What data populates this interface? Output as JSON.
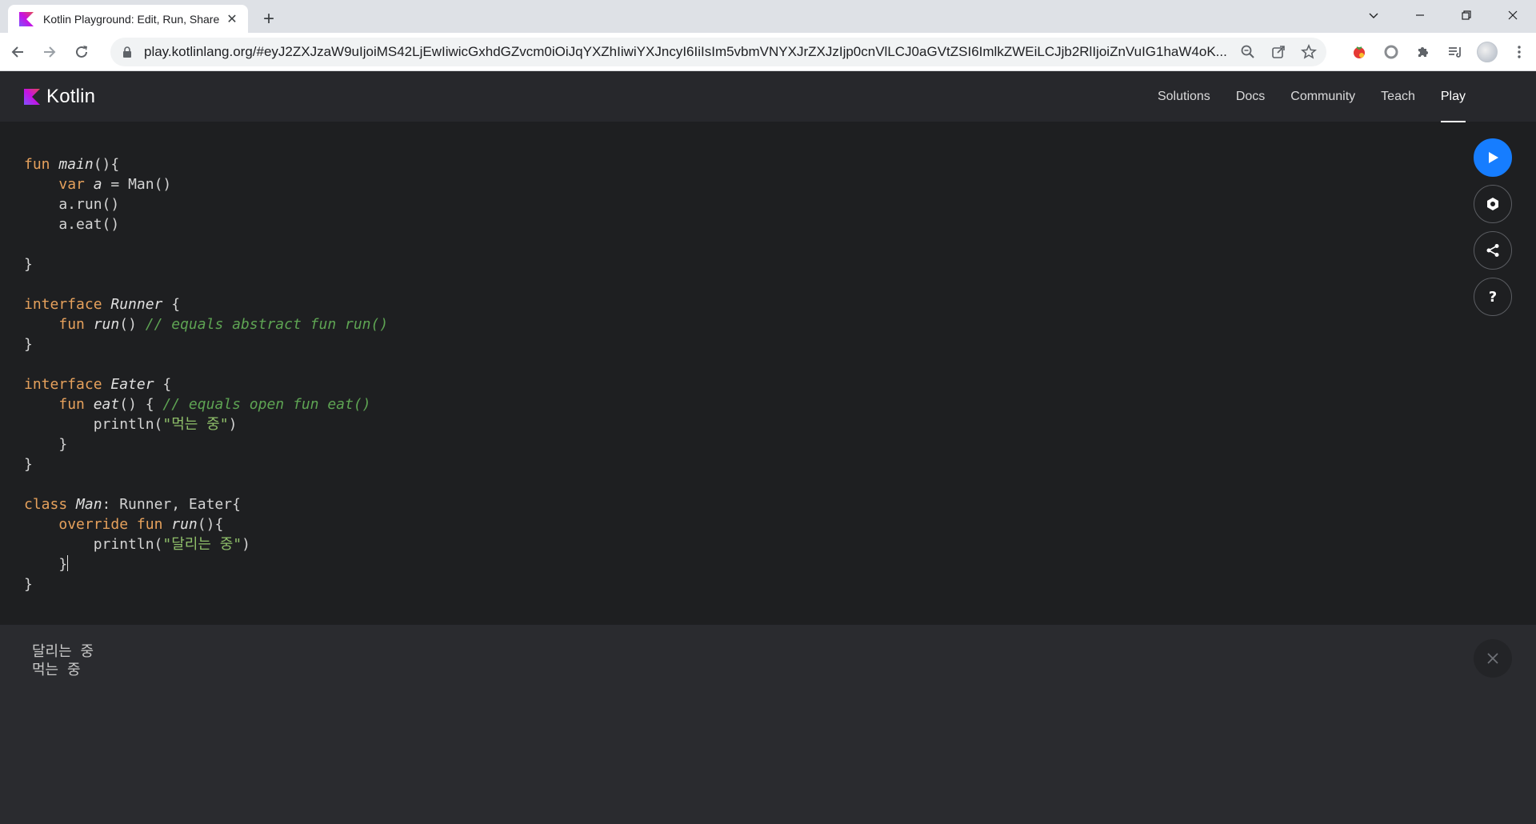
{
  "browser": {
    "tab_title": "Kotlin Playground: Edit, Run, Share Kotlin Code Online",
    "url": "play.kotlinlang.org/#eyJ2ZXJzaW9uIjoiMS42LjEwIiwicGxhdGZvcm0iOiJqYXZhIiwiYXJncyI6IiIsIm5vbmVNYXJrZXJzIjp0cnVlLCJ0aGVtZSI6ImlkZWEiLCJjb2RlIjoiZnVuIG1haW4oK...",
    "icons": [
      "back-icon",
      "forward-icon",
      "reload-icon",
      "lock-icon",
      "zoom-icon",
      "share-icon",
      "star-icon",
      "extensions-icon"
    ]
  },
  "site": {
    "brand": "Kotlin",
    "nav": [
      {
        "label": "Solutions",
        "active": false
      },
      {
        "label": "Docs",
        "active": false
      },
      {
        "label": "Community",
        "active": false
      },
      {
        "label": "Teach",
        "active": false
      },
      {
        "label": "Play",
        "active": true
      }
    ],
    "colors": {
      "accent": "#167dff",
      "keyword": "#e6a15c",
      "comment": "#5ea453",
      "string": "#8fbf6a"
    }
  },
  "editor": {
    "lines": [
      {
        "parts": [
          {
            "t": "fun ",
            "c": "kw"
          },
          {
            "t": "main",
            "c": "fn"
          },
          {
            "t": "(){",
            "c": ""
          }
        ]
      },
      {
        "parts": [
          {
            "t": "    ",
            "c": ""
          },
          {
            "t": "var ",
            "c": "kw"
          },
          {
            "t": "a",
            "c": "fn"
          },
          {
            "t": " = Man()",
            "c": ""
          }
        ]
      },
      {
        "parts": [
          {
            "t": "    a.run()",
            "c": ""
          }
        ]
      },
      {
        "parts": [
          {
            "t": "    a.eat()",
            "c": ""
          }
        ]
      },
      {
        "parts": []
      },
      {
        "parts": [
          {
            "t": "}",
            "c": ""
          }
        ]
      },
      {
        "parts": []
      },
      {
        "parts": [
          {
            "t": "interface ",
            "c": "kw"
          },
          {
            "t": "Runner",
            "c": "fn"
          },
          {
            "t": " {",
            "c": ""
          }
        ]
      },
      {
        "parts": [
          {
            "t": "    ",
            "c": ""
          },
          {
            "t": "fun ",
            "c": "kw"
          },
          {
            "t": "run",
            "c": "fn"
          },
          {
            "t": "() ",
            "c": ""
          },
          {
            "t": "// equals abstract fun run()",
            "c": "cm"
          }
        ]
      },
      {
        "parts": [
          {
            "t": "}",
            "c": ""
          }
        ]
      },
      {
        "parts": []
      },
      {
        "parts": [
          {
            "t": "interface ",
            "c": "kw"
          },
          {
            "t": "Eater",
            "c": "fn"
          },
          {
            "t": " {",
            "c": ""
          }
        ]
      },
      {
        "parts": [
          {
            "t": "    ",
            "c": ""
          },
          {
            "t": "fun ",
            "c": "kw"
          },
          {
            "t": "eat",
            "c": "fn"
          },
          {
            "t": "() { ",
            "c": ""
          },
          {
            "t": "// equals open fun eat()",
            "c": "cm"
          }
        ]
      },
      {
        "parts": [
          {
            "t": "        println(",
            "c": ""
          },
          {
            "t": "\"먹는 중\"",
            "c": "str"
          },
          {
            "t": ")",
            "c": ""
          }
        ]
      },
      {
        "parts": [
          {
            "t": "    }",
            "c": ""
          }
        ]
      },
      {
        "parts": [
          {
            "t": "}",
            "c": ""
          }
        ]
      },
      {
        "parts": []
      },
      {
        "parts": [
          {
            "t": "class ",
            "c": "kw"
          },
          {
            "t": "Man",
            "c": "fn"
          },
          {
            "t": ": Runner, Eater{",
            "c": ""
          }
        ]
      },
      {
        "parts": [
          {
            "t": "    ",
            "c": ""
          },
          {
            "t": "override fun ",
            "c": "kw"
          },
          {
            "t": "run",
            "c": "fn"
          },
          {
            "t": "(){",
            "c": ""
          }
        ]
      },
      {
        "parts": [
          {
            "t": "        println(",
            "c": ""
          },
          {
            "t": "\"달리는 중\"",
            "c": "str"
          },
          {
            "t": ")",
            "c": ""
          }
        ]
      },
      {
        "parts": [
          {
            "t": "    }",
            "c": ""
          }
        ],
        "cursor": true
      },
      {
        "parts": [
          {
            "t": "}",
            "c": ""
          }
        ]
      }
    ]
  },
  "tools": [
    {
      "name": "run-button",
      "icon": "play-icon"
    },
    {
      "name": "settings-button",
      "icon": "hexagon-settings-icon"
    },
    {
      "name": "share-code-button",
      "icon": "share-nodes-icon"
    },
    {
      "name": "help-button",
      "icon": "question-icon",
      "label": "?"
    }
  ],
  "output": {
    "text": "달리는 중\n먹는 중"
  }
}
